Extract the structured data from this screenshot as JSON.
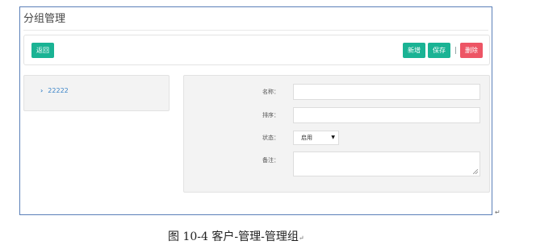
{
  "window": {
    "title": "分组管理"
  },
  "toolbar": {
    "back_label": "返回",
    "new_label": "新增",
    "save_label": "保存",
    "delete_label": "删除",
    "accent_green": "#1ab394",
    "accent_red": "#ed5565"
  },
  "tree": {
    "items": [
      {
        "label": "22222",
        "icon": "chevron-right-icon"
      }
    ]
  },
  "form": {
    "name_label": "名称：",
    "name_value": "",
    "sort_label": "排序：",
    "sort_value": "",
    "status_label": "状态：",
    "status_selected": "启用",
    "note_label": "备注：",
    "note_value": ""
  },
  "caption": {
    "text": "图 10-4  客户-管理-管理组",
    "mark": "↵"
  }
}
